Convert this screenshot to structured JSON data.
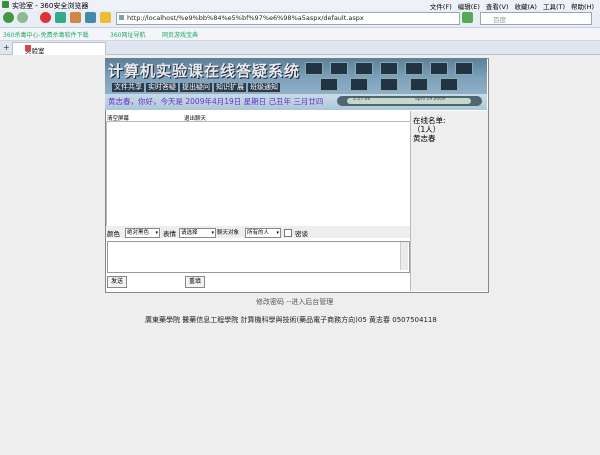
{
  "browser": {
    "window_title": "实验室 - 360安全浏览器",
    "menus": [
      "文件(F)",
      "编辑(E)",
      "查看(V)",
      "收藏(A)",
      "工具(T)",
      "帮助(H)"
    ],
    "address": "http://localhost/%e9%bb%84%e5%bf%97%e6%98%a5aspx/default.aspx",
    "search_placeholder": "百度",
    "bookmarks": [
      "360杀毒中心-免费杀毒软件下载",
      "360网址导航",
      "网页游戏宝典"
    ],
    "tab_label": "实验室"
  },
  "banner": {
    "title": "计算机实验课在线答疑系统",
    "nav": [
      "文件共享",
      "实时答疑",
      "提出疑问",
      "知识扩展",
      "班级通知"
    ],
    "greeting": "黄志春，你好，今天是 2009年4月19日 星期日 己丑年 三月廿四",
    "pill_left": "2:27:06",
    "pill_right": "april 19 2009"
  },
  "chat": {
    "header_left": "清空屏幕",
    "header_right": "退出聊天",
    "toolbar": {
      "color_label": "颜色",
      "color_value": "绝对黑色",
      "emote_label": "表情",
      "emote_value": "请选择",
      "target_label": "聊天对象",
      "target_value": "所有的人",
      "private_label": "密谈"
    },
    "send_label": "发送",
    "reset_label": "重填"
  },
  "online": {
    "title": "在线名单:",
    "count": "（1人）",
    "user": "黄志春"
  },
  "footer": {
    "links": "修改密码 --进入后台管理",
    "credit": "廣東藥學院  醫藥信息工程學院  計算機科學與技術(藥品電子商務方向)05  黄志春  0507504118"
  },
  "colors": {
    "greeting": "#6633cc",
    "banner": "#6f94ad"
  }
}
